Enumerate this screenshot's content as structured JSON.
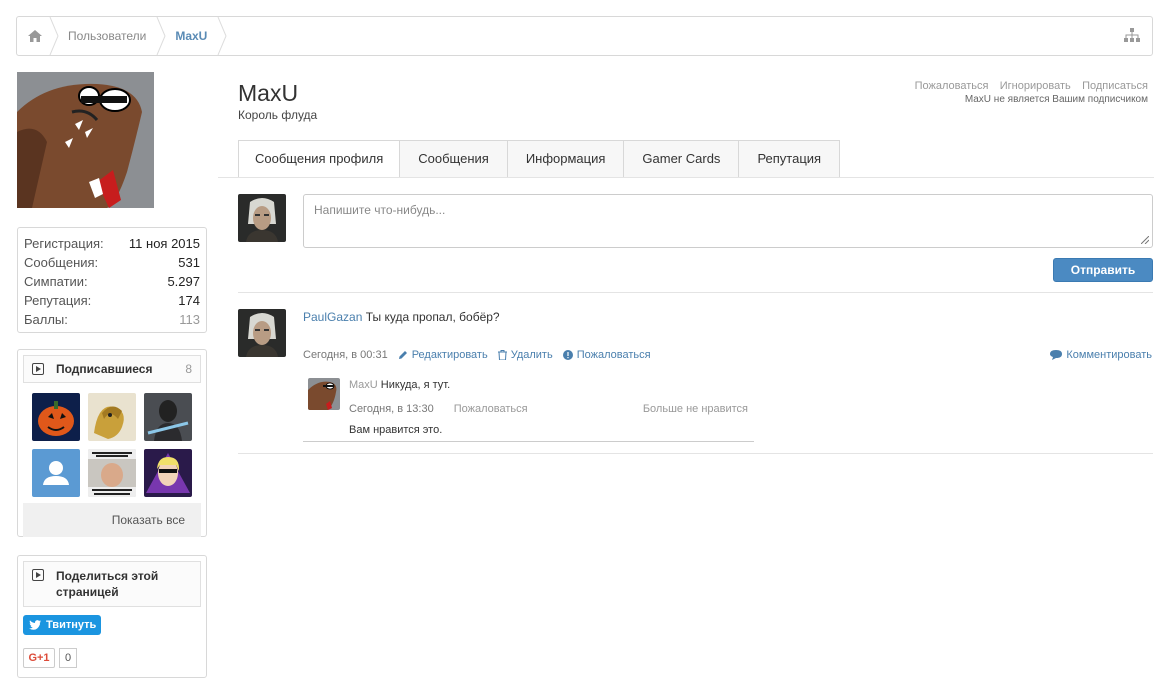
{
  "breadcrumb": {
    "home_icon": "home-icon",
    "items": [
      "Пользователи",
      "MaxU"
    ],
    "sitemap_icon": "sitemap-icon"
  },
  "sidebar": {
    "stats": [
      {
        "label": "Регистрация:",
        "value": "11 ноя 2015"
      },
      {
        "label": "Сообщения:",
        "value": "531"
      },
      {
        "label": "Симпатии:",
        "value": "5.297"
      },
      {
        "label": "Репутация:",
        "value": "174"
      },
      {
        "label": "Баллы:",
        "value": "113"
      }
    ],
    "followers": {
      "title": "Подписавшиеся",
      "count": "8",
      "show_all": "Показать все"
    },
    "share": {
      "title": "Поделиться этой страницей",
      "tweet": "Твитнуть",
      "gplus": "G+1",
      "gplus_count": "0"
    }
  },
  "profile": {
    "name": "MaxU",
    "title": "Король флуда",
    "actions": [
      "Пожаловаться",
      "Игнорировать",
      "Подписаться"
    ],
    "follow_status": "MaxU не является Вашим подписчиком"
  },
  "tabs": [
    "Сообщения профиля",
    "Сообщения",
    "Информация",
    "Gamer Cards",
    "Репутация"
  ],
  "status": {
    "placeholder": "Напишите что-нибудь...",
    "send": "Отправить"
  },
  "post": {
    "author": "PaulGazan",
    "text": " Ты куда пропал, бобёр?",
    "time": "Сегодня, в 00:31",
    "edit": "Редактировать",
    "delete": "Удалить",
    "report": "Пожаловаться",
    "comment": "Комментировать",
    "reply": {
      "author": "MaxU",
      "text": " Никуда, я тут.",
      "time": "Сегодня, в 13:30",
      "report": "Пожаловаться",
      "unlike": "Больше не нравится",
      "likes": "Вам нравится это."
    }
  },
  "colors": {
    "link": "#4a7fad",
    "button": "#4b8ac2",
    "twitter": "#1b95e0",
    "gplus": "#dd4b39"
  }
}
